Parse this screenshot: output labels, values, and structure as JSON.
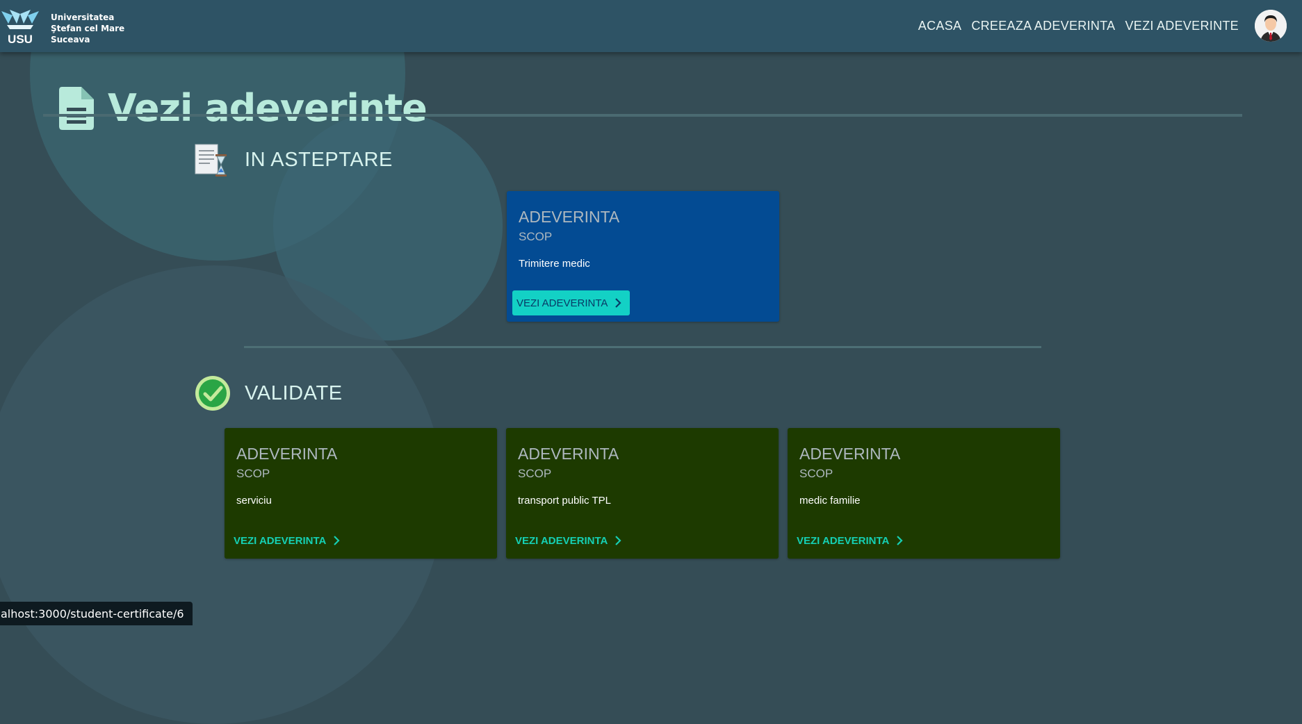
{
  "header": {
    "logo_abbr": "USU",
    "university_name_lines": [
      "Universitatea",
      "Ştefan cel Mare",
      "Suceava"
    ],
    "nav": [
      "ACASA",
      "CREEAZA ADEVERINTA",
      "VEZI ADEVERINTE"
    ]
  },
  "page": {
    "title": "Vezi adeverinte"
  },
  "sections": {
    "pending": {
      "title": "IN ASTEPTARE",
      "cards": [
        {
          "title": "ADEVERINTA",
          "subtitle": "SCOP",
          "purpose": "Trimitere medic",
          "button": "VEZI ADEVERINTA"
        }
      ]
    },
    "validated": {
      "title": "VALIDATE",
      "cards": [
        {
          "title": "ADEVERINTA",
          "subtitle": "SCOP",
          "purpose": "serviciu",
          "button": "VEZI ADEVERINTA"
        },
        {
          "title": "ADEVERINTA",
          "subtitle": "SCOP",
          "purpose": "transport public TPL",
          "button": "VEZI ADEVERINTA"
        },
        {
          "title": "ADEVERINTA",
          "subtitle": "SCOP",
          "purpose": "medic familie",
          "button": "VEZI ADEVERINTA"
        }
      ]
    }
  },
  "status_bar": {
    "url": "alhost:3000/student-certificate/6"
  },
  "icons": {
    "page_title": "document-icon",
    "pending": "hourglass-document-icon",
    "validated": "checkmark-circle-icon",
    "button": "chevron-right-icon",
    "avatar": "user-avatar-icon"
  },
  "colors": {
    "background": "#354d56",
    "topbar": "#2e5365",
    "title": "#b8eadb",
    "pending_card": "#034b93",
    "validated_card": "#1d3a00",
    "accent": "#13d1c5",
    "validated_check": "#2aa545"
  }
}
